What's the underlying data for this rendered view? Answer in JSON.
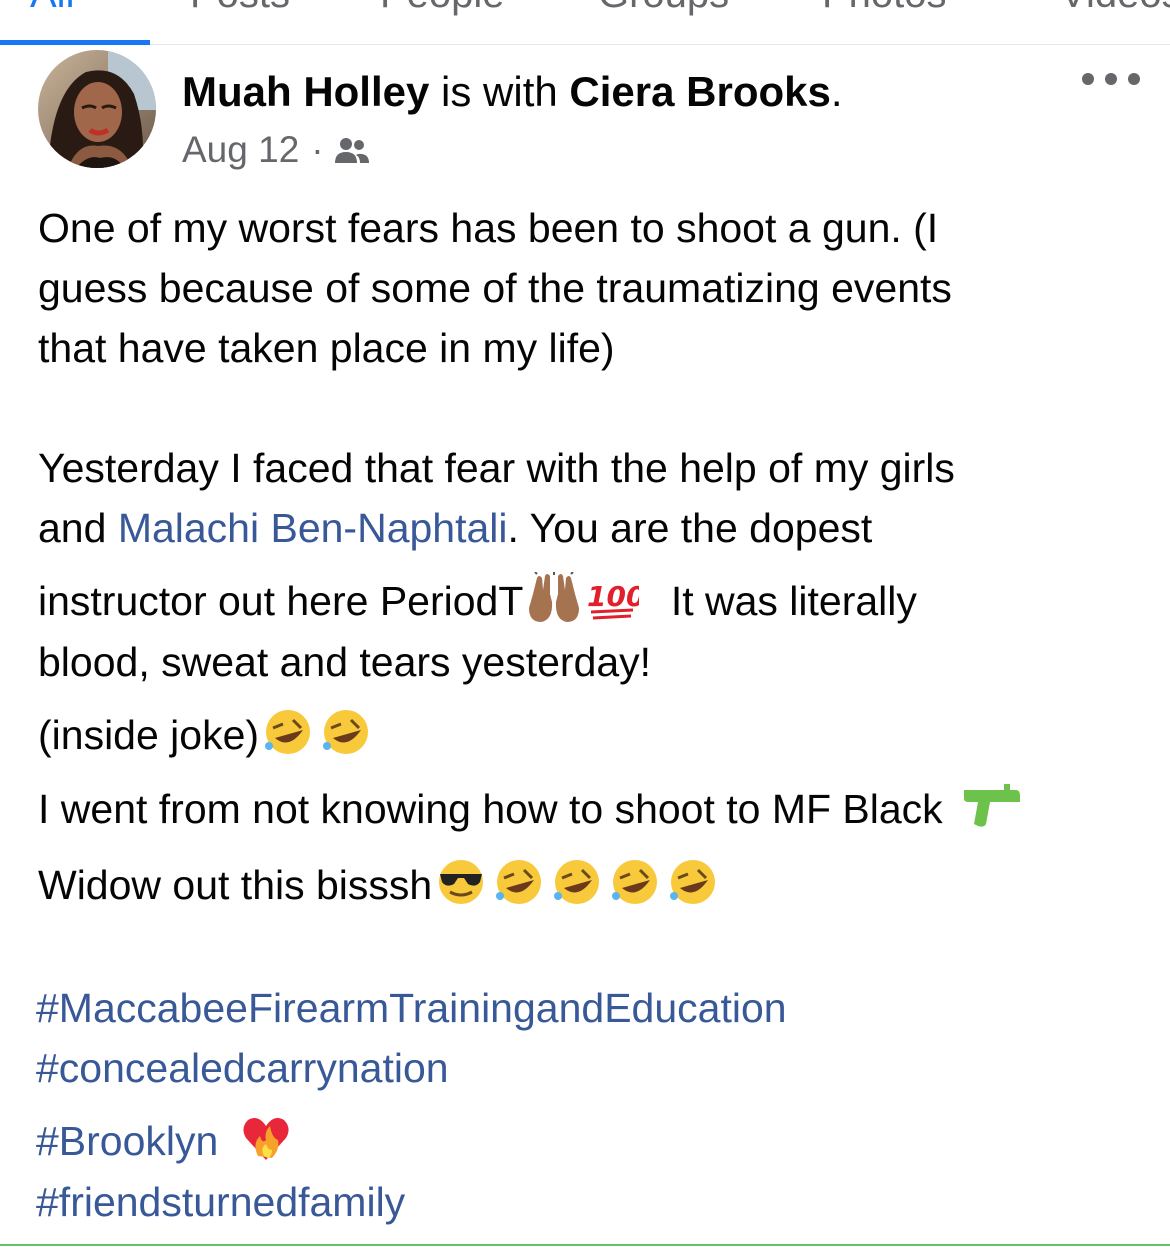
{
  "tabs": [
    {
      "label": "All",
      "active": true
    },
    {
      "label": "Posts",
      "active": false
    },
    {
      "label": "People",
      "active": false
    },
    {
      "label": "Groups",
      "active": false
    },
    {
      "label": "Photos",
      "active": false
    },
    {
      "label": "Videos",
      "active": false
    }
  ],
  "post": {
    "author": "Muah Holley",
    "with_text": " is with ",
    "tagged": "Ciera Brooks",
    "period": ".",
    "date": "Aug 12",
    "meta_sep": "·",
    "audience_icon": "friends-icon",
    "lines": {
      "l1": "One of my worst fears has been to shoot a gun. (I",
      "l2": "guess because of some of the traumatizing events",
      "l3": "that have taken place in my life)",
      "l4": "Yesterday I faced that fear with the help of my girls",
      "l5a": "and ",
      "l5_mention": "Malachi Ben-Naphtali",
      "l5b": ". You are the dopest",
      "l6a": "instructor out here PeriodT",
      "l6b": "It was literally",
      "l7": "blood, sweat and tears yesterday!",
      "l8": "(inside joke)",
      "l9": "I went from not knowing how to shoot to MF Black",
      "l10": "Widow out this bisssh"
    },
    "hashtags": {
      "h1": "#MaccabeeFirearmTrainingandEducation",
      "h2": "#concealedcarrynation",
      "h3": "#Brooklyn",
      "h4": "#friendsturnedfamily"
    },
    "colors": {
      "link": "#385898",
      "secondary_text": "#65676b",
      "accent": "#1877f2"
    }
  }
}
